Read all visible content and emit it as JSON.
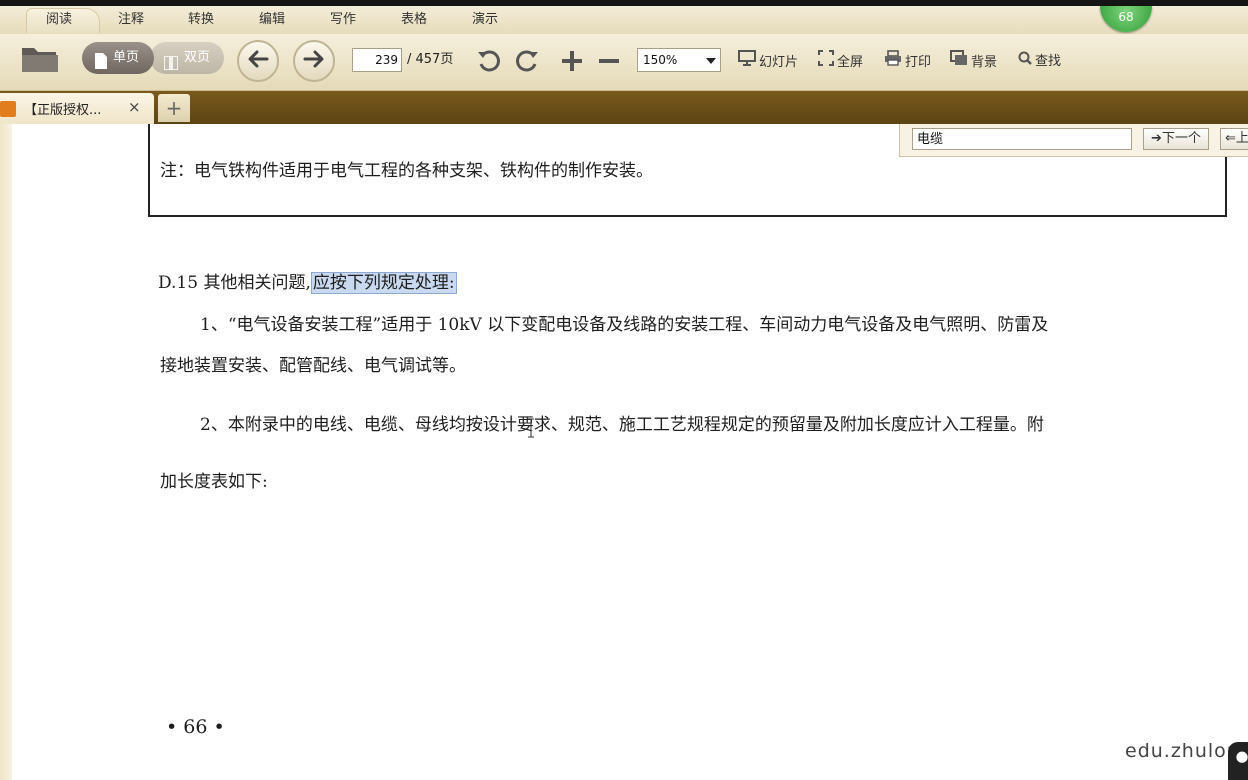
{
  "menubar": {
    "items": [
      "阅读",
      "注释",
      "转换",
      "编辑",
      "写作",
      "表格",
      "演示"
    ],
    "badge": "68"
  },
  "toolbar": {
    "single_page": "单页",
    "double_page": "双页",
    "page_current": "239",
    "page_total": "/ 457页",
    "zoom": "150%",
    "slideshow": "幻灯片",
    "fullscreen": "全屏",
    "print": "打印",
    "background": "背景",
    "find": "查找"
  },
  "tabs": {
    "doc_tab_label": "【正版授权...",
    "close": "×",
    "add": "+"
  },
  "findbar": {
    "query": "电缆",
    "next": "下一个",
    "prev": "上"
  },
  "document": {
    "note": "注：电气铁构件适用于电气工程的各种支架、铁构件的制作安装。",
    "heading_prefix": "D.15  其他相关问题,",
    "heading_highlight": "应按下列规定处理:",
    "p1_line1": "1、“电气设备安装工程”适用于 10kV 以下变配电设备及线路的安装工程、车间动力电气设备及电气照明、防雷及",
    "p1_line2": "接地装置安装、配管配线、电气调试等。",
    "p2_line1": "2、本附录中的电线、电缆、母线均按设计要求、规范、施工工艺规程规定的预留量及附加长度应计入工程量。附",
    "p2_line2": "加长度表如下:",
    "page_number": "• 66 •"
  },
  "watermark": "edu.zhulon",
  "colors": {
    "toolbar_bg": "#efe6c8",
    "tabstrip": "#6b4f17",
    "highlight": "#c9d9ef",
    "badge_green": "#2d9b34"
  }
}
